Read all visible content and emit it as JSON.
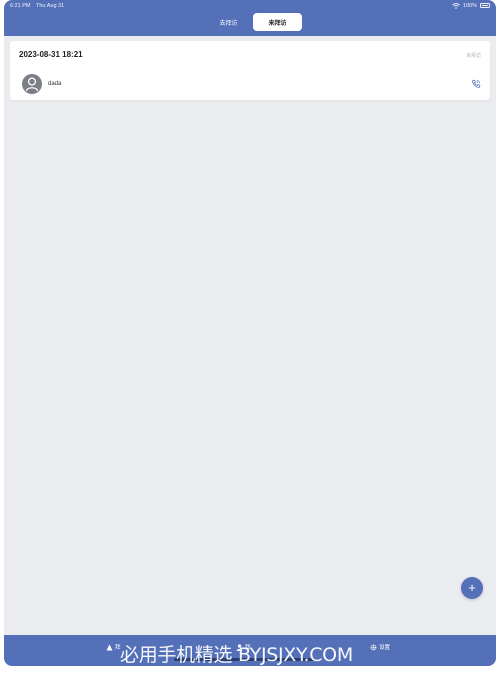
{
  "status_bar": {
    "time": "6:21 PM",
    "date": "Thu Aug 31",
    "battery": "100%"
  },
  "tabs": [
    {
      "label": "去拜访",
      "active": false
    },
    {
      "label": "来拜访",
      "active": true
    }
  ],
  "visit_record": {
    "datetime": "2023-08-31 18:21",
    "status": "未拜访",
    "visitor_name": "dada"
  },
  "fab": {
    "icon": "plus-icon",
    "label": "+"
  },
  "tabbar": {
    "items": [
      {
        "label": "拜",
        "icon": "triangle-icon"
      },
      {
        "label": "拜",
        "icon": "person-icon"
      },
      {
        "label": "设置",
        "icon": "gear-icon"
      }
    ]
  },
  "watermark": "必用手机精选 BYJSJXY.COM",
  "colors": {
    "accent": "#5470b8",
    "background": "#ebecef",
    "card": "#ffffff"
  }
}
